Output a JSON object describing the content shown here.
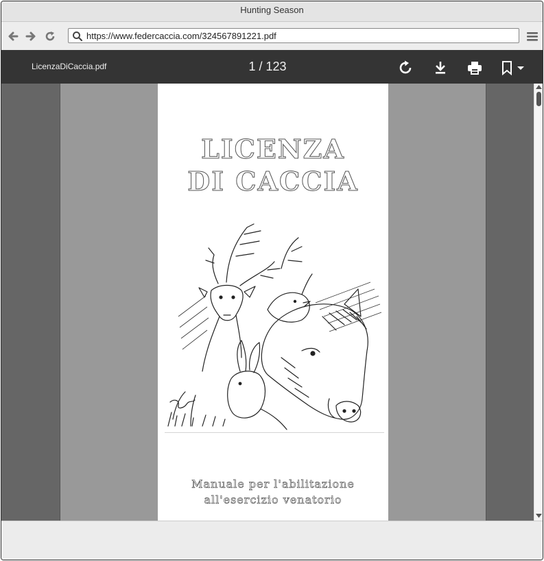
{
  "window": {
    "title": "Hunting Season"
  },
  "browser": {
    "back_icon": "arrow-left-icon",
    "forward_icon": "arrow-right-icon",
    "reload_icon": "reload-icon",
    "search_icon": "search-icon",
    "url": "https://www.federcaccia.com/324567891221.pdf",
    "menu_icon": "hamburger-menu-icon"
  },
  "pdf_toolbar": {
    "filename": "LicenzaDiCaccia.pdf",
    "page_indicator": "1 / 123",
    "icons": [
      "rotate-icon",
      "download-icon",
      "print-icon",
      "bookmark-icon",
      "chevron-down-icon"
    ]
  },
  "document": {
    "title_line1": "LICENZA",
    "title_line2": "DI CACCIA",
    "subtitle_line1": "Manuale per l'abilitazione",
    "subtitle_line2": "all'esercizio venatorio",
    "illustration": "hunting-animals-illustration"
  },
  "colors": {
    "toolbar": "#343434",
    "viewer_background": "#666666",
    "page_margin": "#999999"
  }
}
